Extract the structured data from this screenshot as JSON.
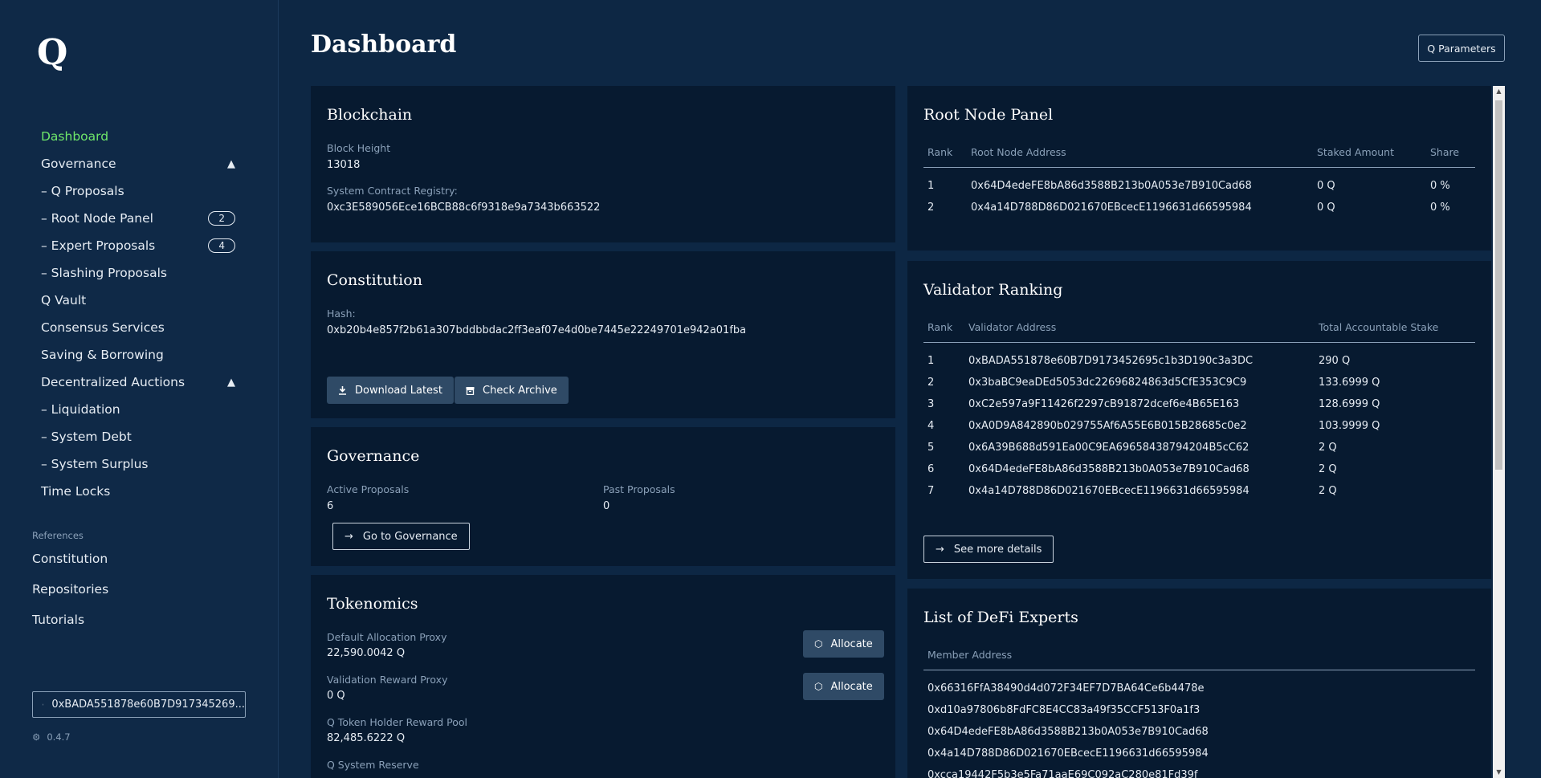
{
  "sidebar": {
    "logo": "Q",
    "nav": [
      {
        "label": "Dashboard"
      },
      {
        "label": "Governance",
        "chevron": "▲"
      },
      {
        "label": "– Q Proposals"
      },
      {
        "label": "– Root Node Panel",
        "badge": "2"
      },
      {
        "label": "– Expert Proposals",
        "badge": "4"
      },
      {
        "label": "– Slashing Proposals"
      },
      {
        "label": "Q Vault"
      },
      {
        "label": "Consensus Services"
      },
      {
        "label": "Saving & Borrowing"
      },
      {
        "label": "Decentralized Auctions",
        "chevron": "▲"
      },
      {
        "label": "– Liquidation"
      },
      {
        "label": "– System Debt"
      },
      {
        "label": "– System Surplus"
      },
      {
        "label": "Time Locks"
      }
    ],
    "references_label": "References",
    "references": [
      "Constitution",
      "Repositories",
      "Tutorials"
    ],
    "wallet_address": "0xBADA551878e60B7D917345269...",
    "version": "0.4.7"
  },
  "header": {
    "title": "Dashboard",
    "params_button": "Q Parameters"
  },
  "blockchain": {
    "title": "Blockchain",
    "block_height_label": "Block Height",
    "block_height": "13018",
    "registry_label": "System Contract Registry:",
    "registry": "0xc3E589056Ece16BCB88c6f9318e9a7343b663522"
  },
  "constitution": {
    "title": "Constitution",
    "hash_label": "Hash:",
    "hash": "0xb20b4e857f2b61a307bddbbdac2ff3eaf07e4d0be7445e22249701e942a01fba",
    "download_button": "Download Latest",
    "archive_button": "Check Archive"
  },
  "governance": {
    "title": "Governance",
    "active_label": "Active Proposals",
    "active": "6",
    "past_label": "Past Proposals",
    "past": "0",
    "go_button": "Go to Governance"
  },
  "tokenomics": {
    "title": "Tokenomics",
    "items": [
      {
        "label": "Default Allocation Proxy",
        "value": "22,590.0042 Q"
      },
      {
        "label": "Validation Reward Proxy",
        "value": "0 Q"
      },
      {
        "label": "Q Token Holder Reward Pool",
        "value": "82,485.6222 Q"
      },
      {
        "label": "Q System Reserve",
        "value": ""
      }
    ],
    "allocate_button": "Allocate"
  },
  "root_node_panel": {
    "title": "Root Node Panel",
    "headers": [
      "Rank",
      "Root Node Address",
      "Staked Amount",
      "Share"
    ],
    "rows": [
      [
        "1",
        "0x64D4edeFE8bA86d3588B213b0A053e7B910Cad68",
        "0 Q",
        "0 %"
      ],
      [
        "2",
        "0x4a14D788D86D021670EBcecE1196631d66595984",
        "0 Q",
        "0 %"
      ]
    ]
  },
  "validator_ranking": {
    "title": "Validator Ranking",
    "headers": [
      "Rank",
      "Validator Address",
      "Total Accountable Stake"
    ],
    "rows": [
      [
        "1",
        "0xBADA551878e60B7D9173452695c1b3D190c3a3DC",
        "290 Q"
      ],
      [
        "2",
        "0x3baBC9eaDEd5053dc22696824863d5CfE353C9C9",
        "133.6999 Q"
      ],
      [
        "3",
        "0xC2e597a9F11426f2297cB91872dcef6e4B65E163",
        "128.6999 Q"
      ],
      [
        "4",
        "0xA0D9A842890b029755Af6A55E6B015B28685c0e2",
        "103.9999 Q"
      ],
      [
        "5",
        "0x6A39B688d591Ea00C9EA69658438794204B5cC62",
        "2 Q"
      ],
      [
        "6",
        "0x64D4edeFE8bA86d3588B213b0A053e7B910Cad68",
        "2 Q"
      ],
      [
        "7",
        "0x4a14D788D86D021670EBcecE1196631d66595984",
        "2 Q"
      ]
    ],
    "details_button": "See more details"
  },
  "defi_experts": {
    "title": "List of DeFi Experts",
    "header": "Member Address",
    "rows": [
      "0x66316FfA38490d4d072F34EF7D7BA64Ce6b4478e",
      "0xd10a97806b8FdFC8E4CC83a49f35CCF513F0a1f3",
      "0x64D4edeFE8bA86d3588B213b0A053e7B910Cad68",
      "0x4a14D788D86D021670EBcecE1196631d66595984",
      "0xcca19442F5b3e5Fa71aaE69C092aC280e81Fd39f"
    ]
  }
}
